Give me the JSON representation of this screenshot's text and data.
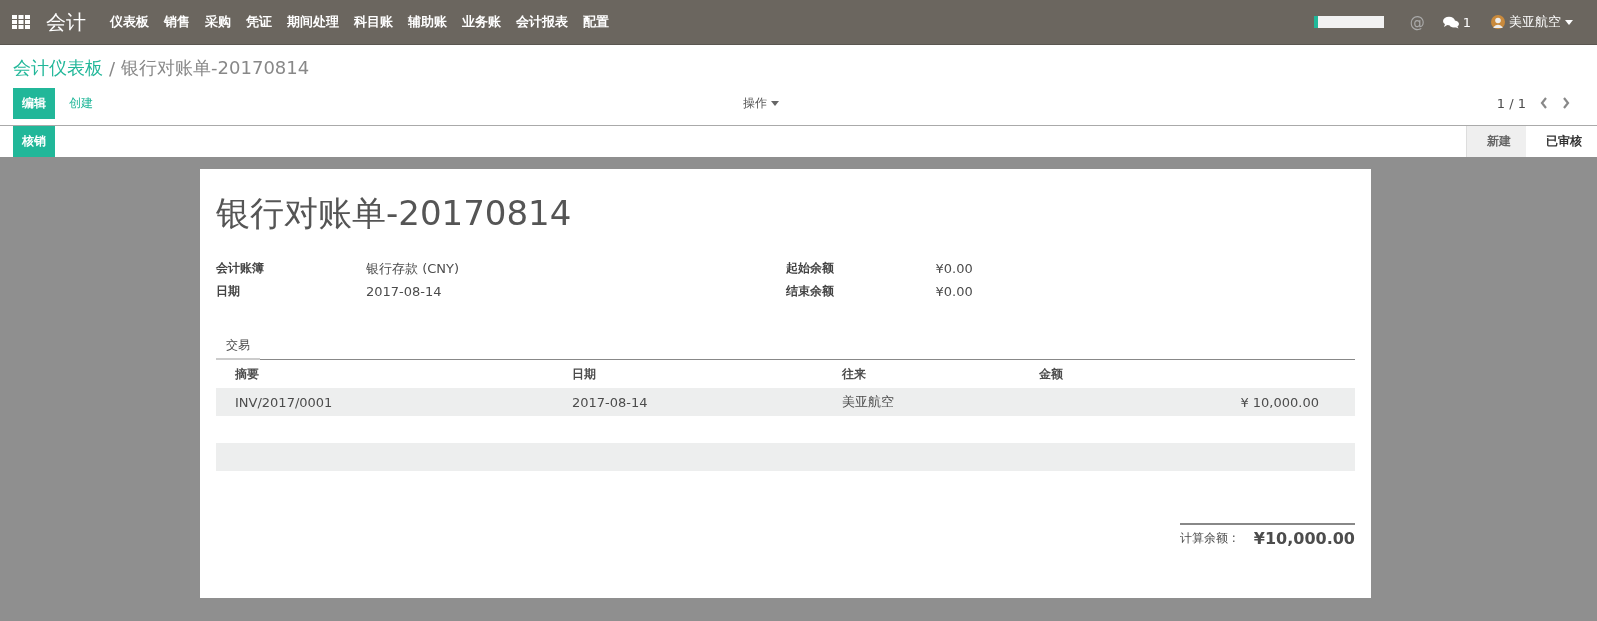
{
  "app": {
    "title": "会计"
  },
  "nav": [
    "仪表板",
    "销售",
    "采购",
    "凭证",
    "期间处理",
    "科目账",
    "辅助账",
    "业务账",
    "会计报表",
    "配置"
  ],
  "systray": {
    "mention": "@",
    "messages_count": "1",
    "user": "美亚航空"
  },
  "breadcrumb": {
    "parent": "会计仪表板",
    "separator": "/",
    "current": "银行对账单-20170814"
  },
  "buttons": {
    "edit": "编辑",
    "create": "创建",
    "action": "操作"
  },
  "pager": "1 / 1",
  "header_buttons": [
    "核销"
  ],
  "statusbar": [
    {
      "label": "新建",
      "selected": false
    },
    {
      "label": "已审核",
      "selected": true
    }
  ],
  "sheet": {
    "title": "银行对账单-20170814",
    "left_fields": [
      {
        "label": "会计账簿",
        "value": "银行存款 (CNY)"
      },
      {
        "label": "日期",
        "value": "2017-08-14"
      }
    ],
    "right_fields": [
      {
        "label": "起始余额",
        "value": "¥0.00"
      },
      {
        "label": "结束余额",
        "value": "¥0.00"
      }
    ],
    "tabs": [
      {
        "label": "交易",
        "selected": true
      }
    ],
    "table": {
      "columns": [
        "摘要",
        "日期",
        "往来",
        "金额"
      ],
      "rows": [
        [
          "INV/2017/0001",
          "2017-08-14",
          "美亚航空",
          "¥ 10,000.00"
        ]
      ]
    },
    "total": {
      "label": "计算余额 :",
      "value": "¥10,000.00"
    }
  }
}
